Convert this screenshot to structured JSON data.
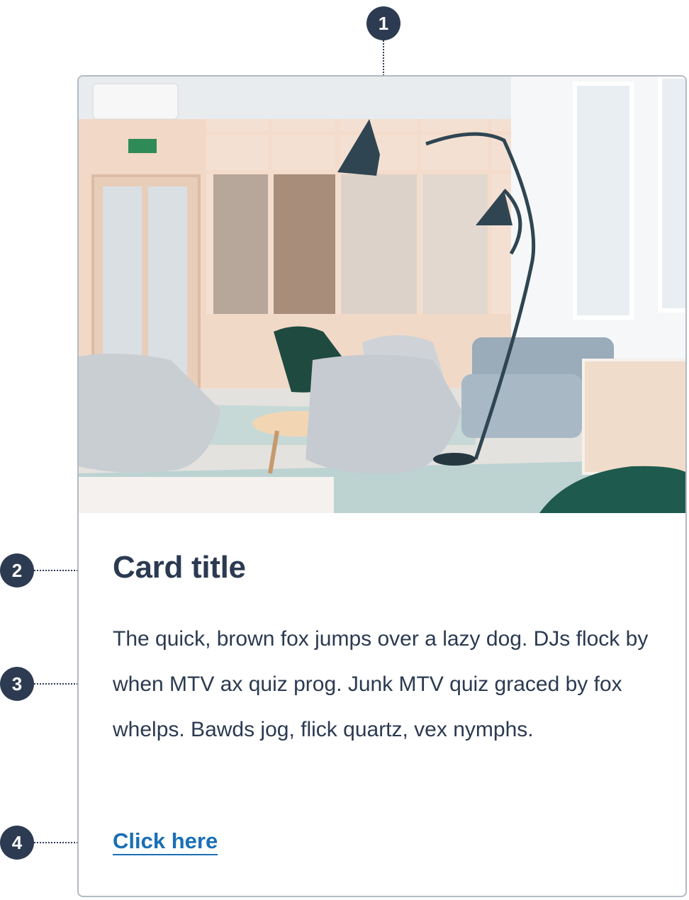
{
  "callouts": [
    "1",
    "2",
    "3",
    "4"
  ],
  "card": {
    "image": "office-lounge-photo",
    "title": "Card title",
    "body": "The quick, brown fox jumps over a lazy dog. DJs flock by when MTV ax quiz prog. Junk MTV quiz graced by fox whelps. Bawds jog, flick quartz, vex nymphs.",
    "link_label": "Click here"
  },
  "colors": {
    "callout": "#2d3b52",
    "text": "#2b3a51",
    "link": "#1a6fb5",
    "border": "#b3bac3"
  }
}
